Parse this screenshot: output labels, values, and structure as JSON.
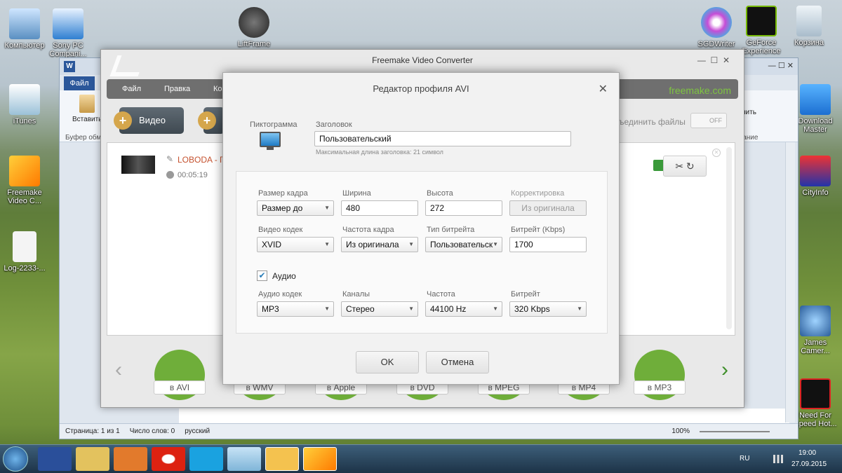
{
  "desktop": {
    "icons_left": [
      {
        "label": "Компьютер"
      },
      {
        "label": "Sony PC Compani..."
      },
      {
        "label": "iTunes"
      },
      {
        "label": "Freemake Video C..."
      },
      {
        "label": "Log-2233-..."
      }
    ],
    "icons_top": [
      {
        "label": "LiftFrame"
      },
      {
        "label": "SGDWriter"
      },
      {
        "label": "GeForce Experience"
      },
      {
        "label": "Корзина"
      }
    ],
    "icons_right": [
      {
        "label": "Download Master"
      },
      {
        "label": "CityInfo"
      },
      {
        "label": "James Camer..."
      },
      {
        "label": "Need For Speed Hot..."
      }
    ]
  },
  "word": {
    "file_tab": "Файл",
    "paste_label": "Вставить",
    "clipboard_label": "Буфер обм...",
    "right_snippets": [
      "нить",
      "вание"
    ],
    "status": {
      "page": "Страница: 1 из 1",
      "words": "Число слов: 0",
      "language": "русский",
      "zoom": "100%"
    }
  },
  "freemake": {
    "title": "Freemake Video Converter",
    "menu": [
      "Файл",
      "Правка",
      "Ко"
    ],
    "logo": "freemake.com",
    "add_video": "Видео",
    "merge_label": "ъединить файлы",
    "toggle": "OFF",
    "file": {
      "name": "LOBODA - Г",
      "duration": "00:05:19"
    },
    "formats": [
      "в AVI",
      "в WMV",
      "в Apple",
      "в DVD",
      "в MPEG",
      "в MP4",
      "в MP3"
    ]
  },
  "dialog": {
    "title": "Редактор профиля AVI",
    "icon_label": "Пиктограмма",
    "heading_label": "Заголовок",
    "heading_value": "Пользовательский",
    "heading_hint": "Максимальная длина заголовка: 21 символ",
    "video": {
      "frame_size_label": "Размер кадра",
      "frame_size_value": "Размер до",
      "width_label": "Ширина",
      "width_value": "480",
      "height_label": "Высота",
      "height_value": "272",
      "correction_label": "Корректировка",
      "correction_button": "Из оригинала",
      "codec_label": "Видео кодек",
      "codec_value": "XVID",
      "fps_label": "Частота кадра",
      "fps_value": "Из оригинала",
      "bitrate_type_label": "Тип битрейта",
      "bitrate_type_value": "Пользовательск",
      "bitrate_label": "Битрейт (Kbps)",
      "bitrate_value": "1700"
    },
    "audio": {
      "checkbox_label": "Аудио",
      "checked": true,
      "codec_label": "Аудио кодек",
      "codec_value": "MP3",
      "channels_label": "Каналы",
      "channels_value": "Стерео",
      "freq_label": "Частота",
      "freq_value": "44100 Hz",
      "bitrate_label": "Битрейт",
      "bitrate_value": "320 Kbps"
    },
    "ok": "OK",
    "cancel": "Отмена"
  },
  "taskbar": {
    "lang": "RU",
    "time": "19:00",
    "date": "27.09.2015"
  }
}
